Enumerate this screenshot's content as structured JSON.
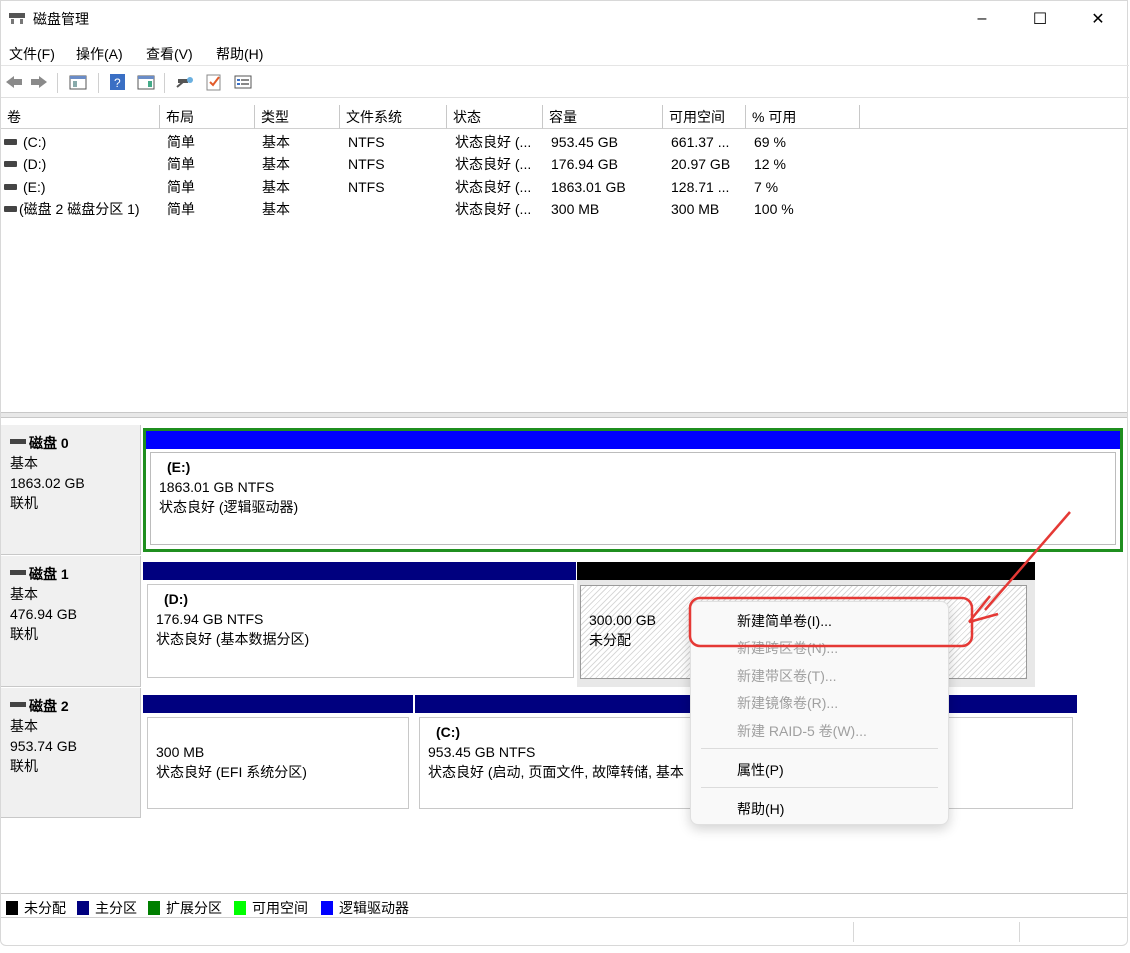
{
  "window": {
    "title": "磁盘管理",
    "minimize": "–",
    "maximize": "☐",
    "close": "✕"
  },
  "menu": [
    "文件(F)",
    "操作(A)",
    "查看(V)",
    "帮助(H)"
  ],
  "toolbar": [
    "back-icon",
    "forward-icon",
    "console-tree-icon",
    "help-icon",
    "properties-icon",
    "connect-icon",
    "checklist-icon",
    "list-icon"
  ],
  "columns": [
    "卷",
    "布局",
    "类型",
    "文件系统",
    "状态",
    "容量",
    "可用空间",
    "% 可用"
  ],
  "rows": [
    [
      "(C:)",
      "简单",
      "基本",
      "NTFS",
      "状态良好 (...",
      "953.45 GB",
      "661.37 ...",
      "69 %"
    ],
    [
      "(D:)",
      "简单",
      "基本",
      "NTFS",
      "状态良好 (...",
      "176.94 GB",
      "20.97 GB",
      "12 %"
    ],
    [
      "(E:)",
      "简单",
      "基本",
      "NTFS",
      "状态良好 (...",
      "1863.01 GB",
      "128.71 ...",
      "7 %"
    ],
    [
      "(磁盘 2 磁盘分区 1)",
      "简单",
      "基本",
      "",
      "状态良好 (...",
      "300 MB",
      "300 MB",
      "100 %"
    ]
  ],
  "disks": [
    {
      "name": "磁盘 0",
      "type": "基本",
      "size": "1863.02 GB",
      "status": "联机",
      "parts": [
        {
          "title": "(E:)",
          "line1": "1863.01 GB NTFS",
          "line2": "状态良好 (逻辑驱动器)"
        }
      ]
    },
    {
      "name": "磁盘 1",
      "type": "基本",
      "size": "476.94 GB",
      "status": "联机",
      "parts": [
        {
          "title": "(D:)",
          "line1": "176.94 GB NTFS",
          "line2": "状态良好 (基本数据分区)"
        },
        {
          "title": "",
          "line1": "300.00 GB",
          "line2": "未分配"
        }
      ]
    },
    {
      "name": "磁盘 2",
      "type": "基本",
      "size": "953.74 GB",
      "status": "联机",
      "parts": [
        {
          "title": "",
          "line1": "300 MB",
          "line2": "状态良好 (EFI 系统分区)"
        },
        {
          "title": "(C:)",
          "line1": "953.45 GB NTFS",
          "line2": "状态良好 (启动, 页面文件, 故障转储, 基本"
        }
      ]
    }
  ],
  "legend": [
    {
      "label": "未分配",
      "color": "#000000"
    },
    {
      "label": "主分区",
      "color": "#00007f"
    },
    {
      "label": "扩展分区",
      "color": "#007f00"
    },
    {
      "label": "可用空间",
      "color": "#00ff00"
    },
    {
      "label": "逻辑驱动器",
      "color": "#0000ff"
    }
  ],
  "context_menu": {
    "items": [
      {
        "label": "新建简单卷(I)...",
        "enabled": true
      },
      {
        "label": "新建跨区卷(N)...",
        "enabled": false
      },
      {
        "label": "新建带区卷(T)...",
        "enabled": false
      },
      {
        "label": "新建镜像卷(R)...",
        "enabled": false
      },
      {
        "label": "新建 RAID-5 卷(W)...",
        "enabled": false
      },
      {
        "label": "属性(P)",
        "enabled": true
      },
      {
        "label": "帮助(H)",
        "enabled": true
      }
    ]
  },
  "annotation_color": "#e53935"
}
